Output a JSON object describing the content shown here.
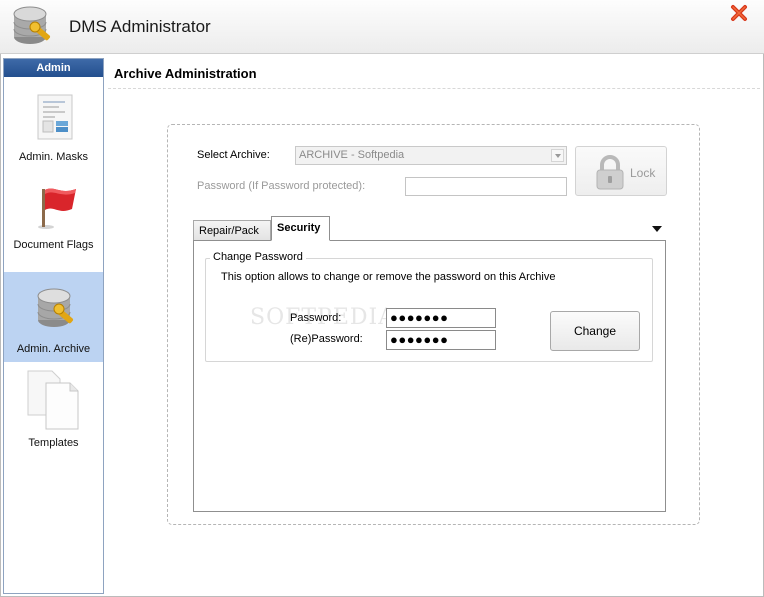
{
  "window": {
    "title": "DMS Administrator",
    "close_icon": "close-icon",
    "accent_color": "#2c5794"
  },
  "sidebar": {
    "header": "Admin",
    "items": [
      {
        "label": "Admin. Masks",
        "icon": "masks-icon",
        "selected": false
      },
      {
        "label": "Document Flags",
        "icon": "flag-icon",
        "selected": false
      },
      {
        "label": "Admin. Archive",
        "icon": "database-key-icon",
        "selected": true
      },
      {
        "label": "Templates",
        "icon": "templates-icon",
        "selected": false
      }
    ]
  },
  "main": {
    "title": "Archive Administration",
    "select_archive_label": "Select Archive:",
    "archive_selected": "ARCHIVE - Softpedia",
    "archive_password_label": "Password (If Password protected):",
    "archive_password_value": "",
    "lock_label": "Lock",
    "tabs": [
      {
        "label": "Repair/Pack",
        "active": false
      },
      {
        "label": "Security",
        "active": true
      }
    ],
    "security": {
      "group_title": "Change Password",
      "description": "This option allows to change or remove the password on this Archive",
      "password_label": "Password:",
      "password_value": "●●●●●●●",
      "repassword_label": "(Re)Password:",
      "repassword_value": "●●●●●●●",
      "change_label": "Change"
    }
  },
  "watermark": "SOFTPEDIA"
}
